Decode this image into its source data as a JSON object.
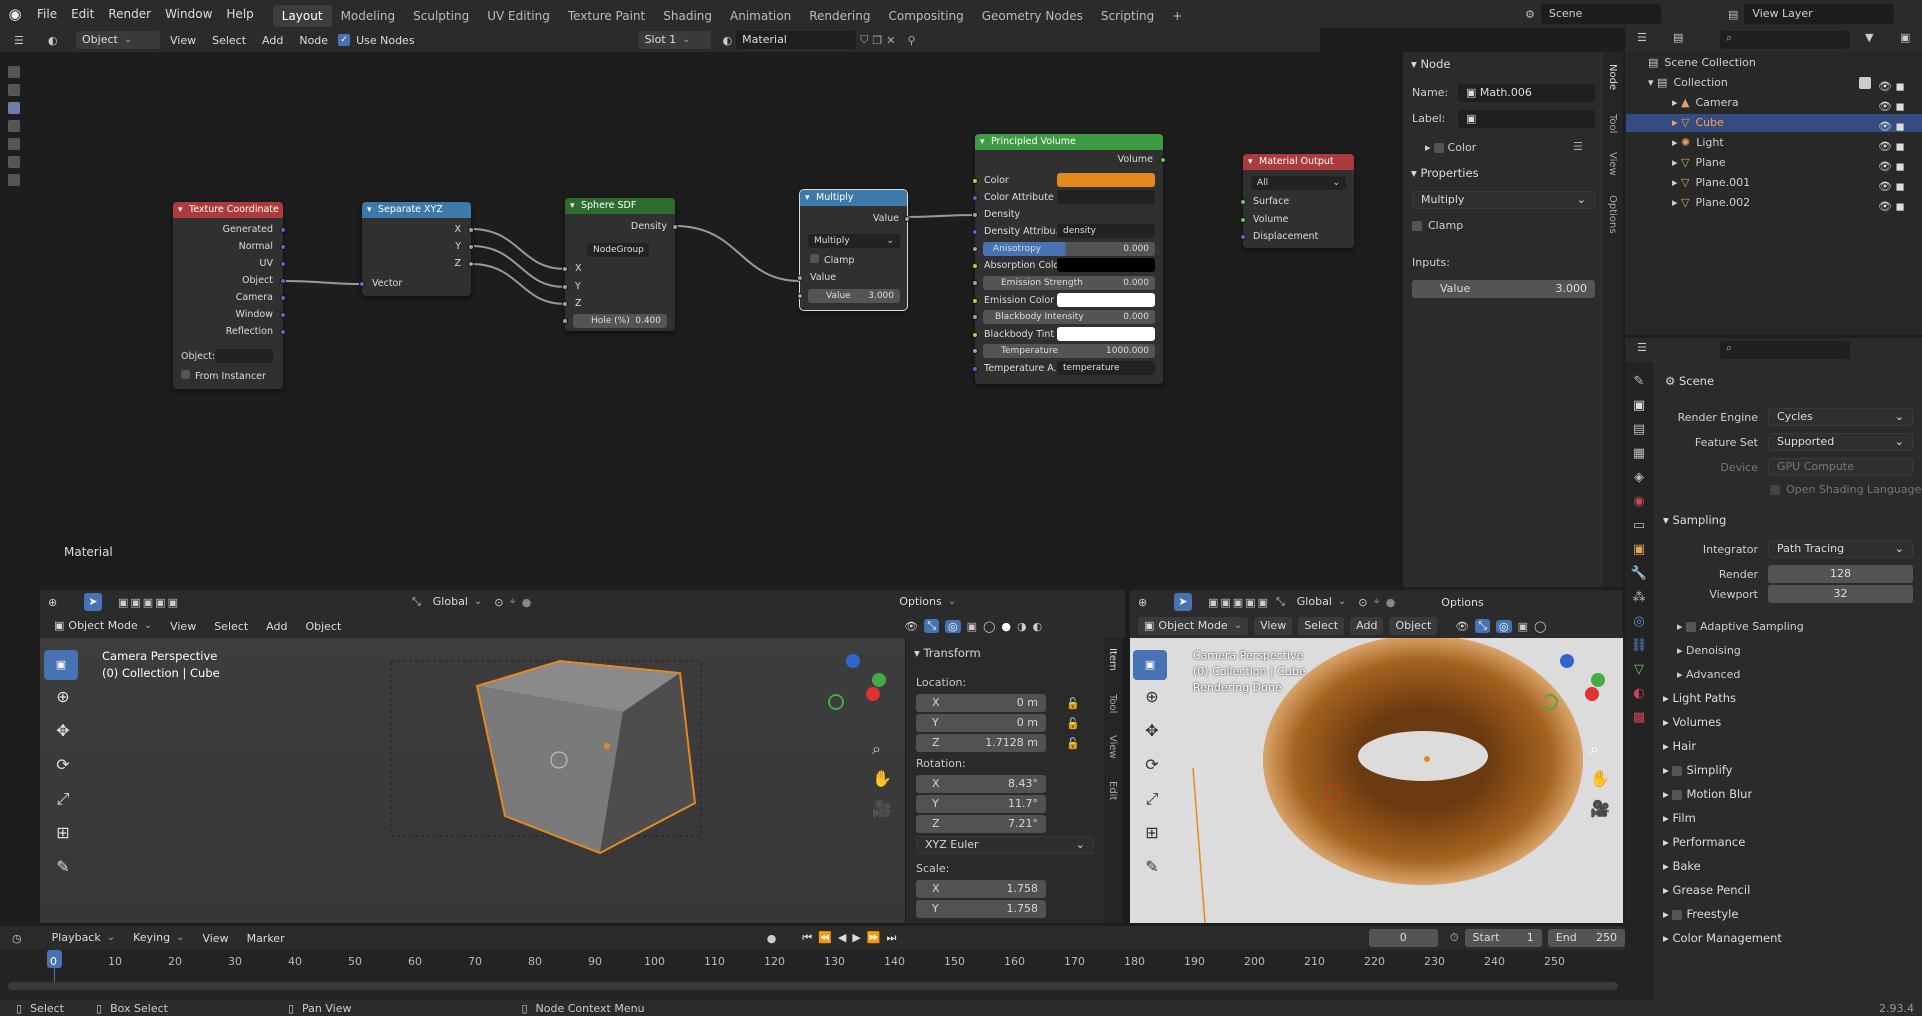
{
  "topbar": {
    "menus": [
      "File",
      "Edit",
      "Render",
      "Window",
      "Help"
    ],
    "workspaces": [
      "Layout",
      "Modeling",
      "Sculpting",
      "UV Editing",
      "Texture Paint",
      "Shading",
      "Animation",
      "Rendering",
      "Compositing",
      "Geometry Nodes",
      "Scripting"
    ],
    "add_tab": "+",
    "scene": "Scene",
    "view_layer": "View Layer"
  },
  "node_header": {
    "mode": "Object",
    "view": "View",
    "select": "Select",
    "add": "Add",
    "node": "Node",
    "use_nodes": "Use Nodes",
    "slot": "Slot 1",
    "material": "Material"
  },
  "editor_label": "Material",
  "nodes": {
    "texcoord": {
      "title": "Texture Coordinate",
      "outputs": [
        "Generated",
        "Normal",
        "UV",
        "Object",
        "Camera",
        "Window",
        "Reflection"
      ],
      "object_label": "Object:",
      "from_instancer": "From Instancer"
    },
    "sepxyz": {
      "title": "Separate XYZ",
      "outputs": [
        "X",
        "Y",
        "Z"
      ],
      "input": "Vector"
    },
    "sdf": {
      "title": "Sphere SDF",
      "output": "Density",
      "group": "NodeGroup",
      "inputs": [
        "X",
        "Y",
        "Z"
      ],
      "hole_label": "Hole (%)",
      "hole_value": "0.400"
    },
    "multiply": {
      "title": "Multiply",
      "output": "Value",
      "op": "Multiply",
      "clamp": "Clamp",
      "in1": "Value",
      "in2_label": "Value",
      "in2_value": "3.000"
    },
    "pvol": {
      "title": "Principled Volume",
      "output": "Volume",
      "rows": [
        "Color",
        "Color Attribute",
        "Density",
        "Density Attribu...",
        "Anisotropy",
        "Absorption Colo",
        "Emission Strength",
        "Emission Color",
        "Blackbody Intensity",
        "Blackbody Tint",
        "Temperature",
        "Temperature A..."
      ],
      "density_attr": "density",
      "anisotropy": "0.000",
      "emission_strength": "0.000",
      "blackbody_intensity": "0.000",
      "temperature": "1000.000",
      "temp_attr": "temperature"
    },
    "matout": {
      "title": "Material Output",
      "target": "All",
      "inputs": [
        "Surface",
        "Volume",
        "Displacement"
      ]
    }
  },
  "npanel": {
    "section": "Node",
    "name_label": "Name:",
    "name_value": "Math.006",
    "label_label": "Label:",
    "color": "Color",
    "properties": "Properties",
    "op": "Multiply",
    "clamp": "Clamp",
    "inputs_label": "Inputs:",
    "value_label": "Value",
    "value": "3.000",
    "tabs": [
      "Node",
      "Tool",
      "View",
      "Options"
    ]
  },
  "outliner": {
    "root": "Scene Collection",
    "collection": "Collection",
    "items": [
      "Camera",
      "Cube",
      "Light",
      "Plane",
      "Plane.001",
      "Plane.002"
    ]
  },
  "props": {
    "scene": "Scene",
    "render_engine_label": "Render Engine",
    "render_engine": "Cycles",
    "feature_set_label": "Feature Set",
    "feature_set": "Supported",
    "device_label": "Device",
    "device": "GPU Compute",
    "osl": "Open Shading Language",
    "sampling": "Sampling",
    "integrator_label": "Integrator",
    "integrator": "Path Tracing",
    "render_label": "Render",
    "render_val": "128",
    "viewport_label": "Viewport",
    "viewport_val": "32",
    "adaptive": "Adaptive Sampling",
    "denoising": "Denoising",
    "advanced": "Advanced",
    "sections": [
      "Light Paths",
      "Volumes",
      "Hair",
      "Simplify",
      "Motion Blur",
      "Film",
      "Performance",
      "Bake",
      "Grease Pencil",
      "Freestyle",
      "Color Management"
    ]
  },
  "vp1": {
    "header": {
      "global": "Global",
      "options": "Options",
      "mode": "Object Mode",
      "view": "View",
      "select": "Select",
      "add": "Add",
      "object": "Object"
    },
    "title": "Camera Perspective",
    "subtitle": "(0) Collection | Cube"
  },
  "transform": {
    "title": "Transform",
    "location": "Location:",
    "rotation": "Rotation:",
    "scale": "Scale:",
    "euler": "XYZ Euler",
    "loc": [
      {
        "a": "X",
        "v": "0 m"
      },
      {
        "a": "Y",
        "v": "0 m"
      },
      {
        "a": "Z",
        "v": "1.7128 m"
      }
    ],
    "rot": [
      {
        "a": "X",
        "v": "8.43°"
      },
      {
        "a": "Y",
        "v": "11.7°"
      },
      {
        "a": "Z",
        "v": "7.21°"
      }
    ],
    "scl": [
      {
        "a": "X",
        "v": "1.758"
      },
      {
        "a": "Y",
        "v": "1.758"
      }
    ],
    "tabs": [
      "Item",
      "Tool",
      "View",
      "Edit"
    ]
  },
  "vp2": {
    "header": {
      "global": "Global",
      "options": "Options",
      "mode": "Object Mode",
      "view": "View",
      "select": "Select",
      "add": "Add",
      "object": "Object"
    },
    "title": "Camera Perspective",
    "subtitle": "(0) Collection | Cube",
    "status": "Rendering Done"
  },
  "timeline": {
    "playback": "Playback",
    "keying": "Keying",
    "view": "View",
    "marker": "Marker",
    "frame": "0",
    "start_label": "Start",
    "start": "1",
    "end_label": "End",
    "end": "250",
    "ticks": [
      "0",
      "10",
      "20",
      "30",
      "40",
      "50",
      "60",
      "70",
      "80",
      "90",
      "100",
      "110",
      "120",
      "130",
      "140",
      "150",
      "160",
      "170",
      "180",
      "190",
      "200",
      "210",
      "220",
      "230",
      "240",
      "250"
    ]
  },
  "statusbar": {
    "select": "Select",
    "box": "Box Select",
    "pan": "Pan View",
    "ctx": "Node Context Menu",
    "version": "2.93.4"
  },
  "colors": {
    "accent": "#4772b3",
    "orange": "#e38a1e",
    "tex_header": "#ae3b3b",
    "sep_header": "#3e7aa9",
    "group_header": "#2e6b2e",
    "math_header": "#3e7aa9",
    "pvol_header": "#3b9a42",
    "out_header": "#ae3b3b"
  }
}
